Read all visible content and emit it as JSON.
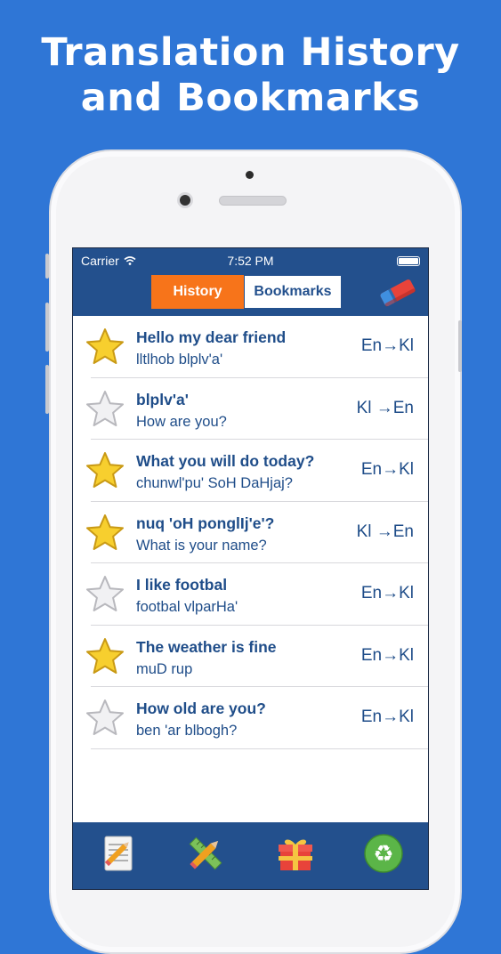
{
  "headline": {
    "line1": "Translation History",
    "line2": "and Bookmarks"
  },
  "status_bar": {
    "carrier": "Carrier",
    "time": "7:52 PM"
  },
  "segments": {
    "history": "History",
    "bookmarks": "Bookmarks",
    "selected": "History"
  },
  "colors": {
    "background": "#2f76d6",
    "bar": "#23508d",
    "accent": "#f7741a",
    "text": "#1f4d89"
  },
  "entries": [
    {
      "source": "Hello my dear friend",
      "translation": "lltlhob blplv'a'",
      "direction": "En→Kl",
      "bookmarked": true
    },
    {
      "source": "blplv'a'",
      "translation": "How are you?",
      "direction": "Kl →En",
      "bookmarked": false
    },
    {
      "source": "What you will do today?",
      "translation": "chunwl'pu' SoH DaHjaj?",
      "direction": "En→Kl",
      "bookmarked": true
    },
    {
      "source": "nuq 'oH ponglIj'e'?",
      "translation": "What is your name?",
      "direction": "Kl →En",
      "bookmarked": true
    },
    {
      "source": "I like footbal",
      "translation": "footbal vlparHa'",
      "direction": "En→Kl",
      "bookmarked": false
    },
    {
      "source": "The weather is fine",
      "translation": "muD rup",
      "direction": "En→Kl",
      "bookmarked": true
    },
    {
      "source": "How old are you?",
      "translation": "ben 'ar blbogh?",
      "direction": "En→Kl",
      "bookmarked": false
    }
  ],
  "icons": {
    "clear": "eraser-icon",
    "tabs": [
      "notepad-icon",
      "pencil-ruler-icon",
      "gift-icon",
      "recycle-icon"
    ]
  }
}
